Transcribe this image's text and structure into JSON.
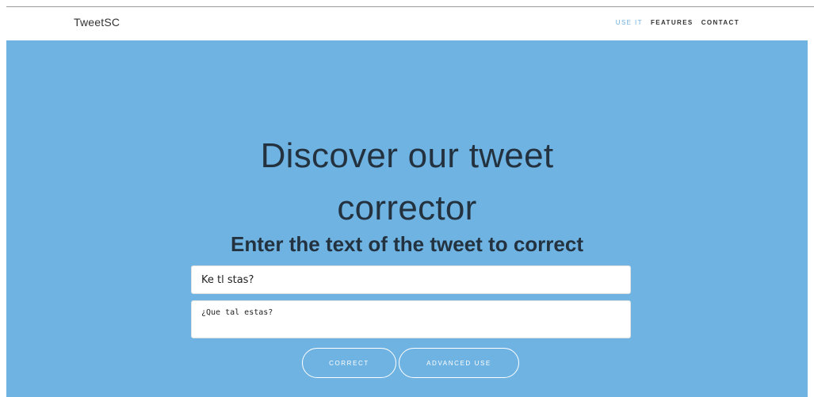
{
  "navbar": {
    "brand": "TweetSC",
    "links": [
      {
        "label": "USE IT",
        "active": true
      },
      {
        "label": "FEATURES",
        "active": false
      },
      {
        "label": "CONTACT",
        "active": false
      }
    ]
  },
  "hero": {
    "title_line1": "Discover our tweet",
    "title_line2": "corrector",
    "subtitle": "Enter the text of the tweet to correct",
    "input_value": "Ke tl stas?",
    "output_value": "¿Que tal estas?",
    "buttons": {
      "correct": "CORRECT",
      "advanced": "ADVANCED USE"
    }
  },
  "colors": {
    "hero_background": "#6fb3e3",
    "active_link": "#6aaedf",
    "text_dark": "#23323e"
  }
}
